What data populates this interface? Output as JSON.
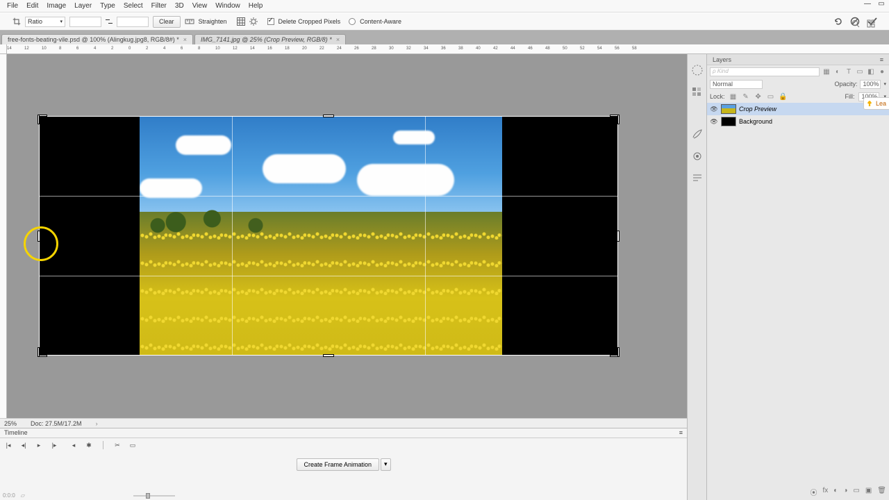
{
  "menu": [
    "File",
    "Edit",
    "Image",
    "Layer",
    "Type",
    "Select",
    "Filter",
    "3D",
    "View",
    "Window",
    "Help"
  ],
  "options_bar": {
    "ratio_label": "Ratio",
    "clear": "Clear",
    "straighten": "Straighten",
    "delete_cropped": "Delete Cropped Pixels",
    "content_aware": "Content-Aware"
  },
  "tabs": [
    {
      "title": "free-fonts-beating-vile.psd @ 100% (Alingkug.jpg8, RGB/8#) *"
    },
    {
      "title": "IMG_7141.jpg @ 25% (Crop Preview, RGB/8) *"
    }
  ],
  "ruler_marks": [
    -14,
    -12,
    -10,
    -8,
    -6,
    -4,
    -2,
    0,
    2,
    4,
    6,
    8,
    10,
    12,
    14,
    16,
    18,
    20,
    22,
    24,
    26,
    28,
    30,
    32,
    34,
    36,
    38,
    40,
    42,
    44,
    46,
    48,
    50,
    52,
    54,
    56,
    58
  ],
  "status": {
    "zoom": "25%",
    "doc": "Doc: 27.5M/17.2M"
  },
  "timeline": {
    "label": "Timeline",
    "create_btn": "Create Frame Animation"
  },
  "layers": {
    "tab": "Layers",
    "kind_ph": "ρ Kind",
    "blend": "Normal",
    "opacity_lbl": "Opacity:",
    "opacity": "100%",
    "lock_lbl": "Lock:",
    "fill_lbl": "Fill:",
    "fill": "100%",
    "items": [
      {
        "name": "Crop Preview",
        "thumb": "photo",
        "selected": true
      },
      {
        "name": "Background",
        "thumb": "black",
        "selected": false
      }
    ]
  },
  "learn_sidebar": "Lea",
  "footer_status": "0:0:0"
}
